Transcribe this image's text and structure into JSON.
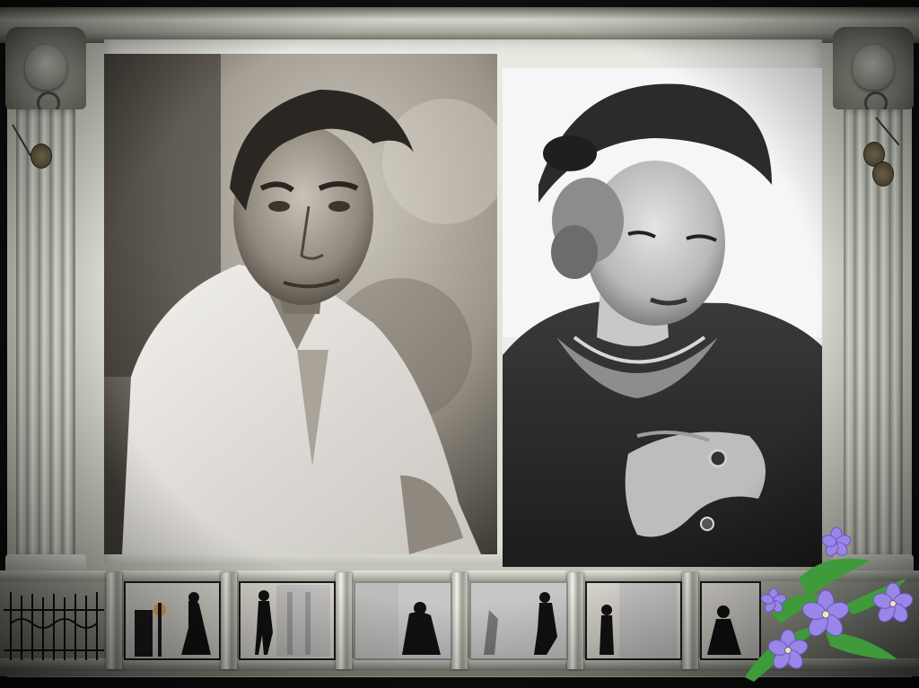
{
  "scene": {
    "photos": [
      {
        "subject": "man"
      },
      {
        "subject": "woman"
      }
    ]
  },
  "colors": {
    "frame_stone": "#d6d8cd",
    "photo_sepia": "#7c766a",
    "photo_bw": "#e8e8e8",
    "flower_violet": "#9a86e6",
    "leaf_green": "#3f9b3a",
    "silhouette": "#111111"
  }
}
